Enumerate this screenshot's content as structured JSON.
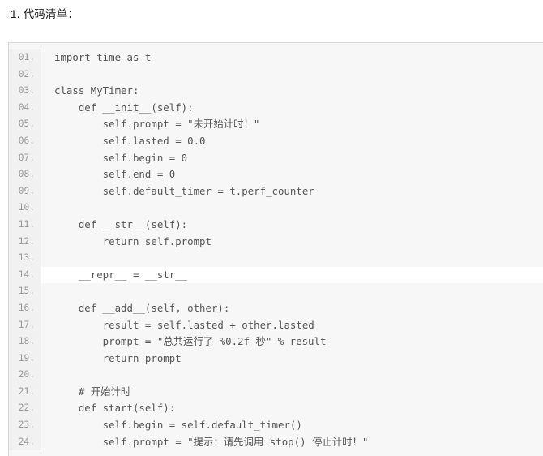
{
  "page": {
    "title": "1. 代码清单：",
    "background_color": "#ffffff",
    "text_color": "#1a1a1a"
  },
  "code_block": {
    "gutter_background": "#f1f1f1",
    "code_background": "#f7f7f7",
    "highlight_background": "#ffffff",
    "border_color": "#d7d7d7",
    "line_number_color": "#9a9a9a",
    "code_text_color": "#555555",
    "language": "python",
    "highlighted_line": 14,
    "lines": [
      {
        "no": "01.",
        "text": "import time as t"
      },
      {
        "no": "02.",
        "text": ""
      },
      {
        "no": "03.",
        "text": "class MyTimer:"
      },
      {
        "no": "04.",
        "text": "    def __init__(self):"
      },
      {
        "no": "05.",
        "text": "        self.prompt = \"未开始计时！\""
      },
      {
        "no": "06.",
        "text": "        self.lasted = 0.0"
      },
      {
        "no": "07.",
        "text": "        self.begin = 0"
      },
      {
        "no": "08.",
        "text": "        self.end = 0"
      },
      {
        "no": "09.",
        "text": "        self.default_timer = t.perf_counter"
      },
      {
        "no": "10.",
        "text": ""
      },
      {
        "no": "11.",
        "text": "    def __str__(self):"
      },
      {
        "no": "12.",
        "text": "        return self.prompt"
      },
      {
        "no": "13.",
        "text": ""
      },
      {
        "no": "14.",
        "text": "    __repr__ = __str__"
      },
      {
        "no": "15.",
        "text": ""
      },
      {
        "no": "16.",
        "text": "    def __add__(self, other):"
      },
      {
        "no": "17.",
        "text": "        result = self.lasted + other.lasted"
      },
      {
        "no": "18.",
        "text": "        prompt = \"总共运行了 %0.2f 秒\" % result"
      },
      {
        "no": "19.",
        "text": "        return prompt"
      },
      {
        "no": "20.",
        "text": ""
      },
      {
        "no": "21.",
        "text": "    # 开始计时"
      },
      {
        "no": "22.",
        "text": "    def start(self):"
      },
      {
        "no": "23.",
        "text": "        self.begin = self.default_timer()"
      },
      {
        "no": "24.",
        "text": "        self.prompt = \"提示：请先调用 stop() 停止计时！\""
      }
    ]
  }
}
